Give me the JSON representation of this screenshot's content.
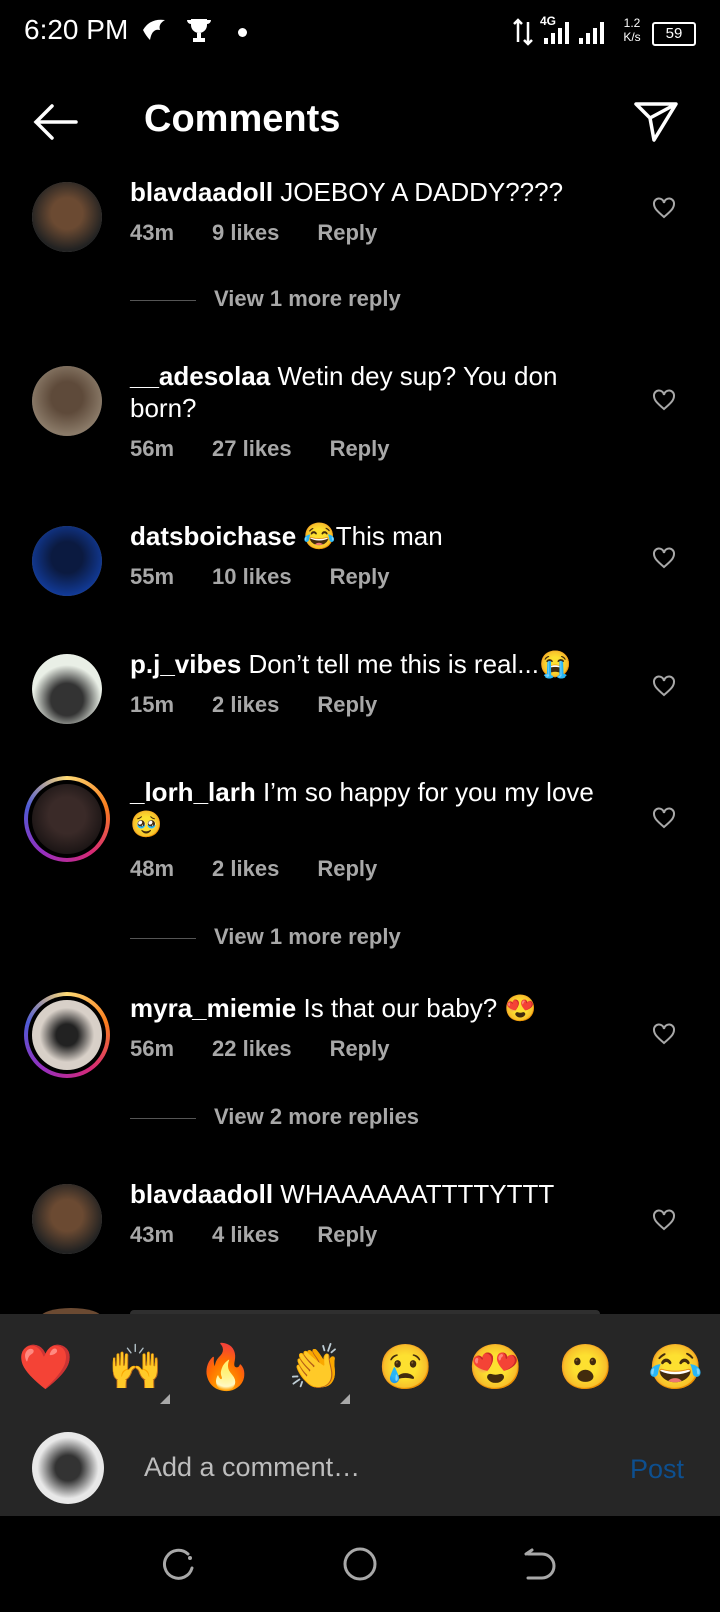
{
  "status_bar": {
    "time": "6:20 PM",
    "network": "4G",
    "speed_value": "1.2",
    "speed_unit": "K/s",
    "battery": "59"
  },
  "header": {
    "title": "Comments"
  },
  "comments": [
    {
      "user": "blavdaadoll",
      "text": "JOEBOY A DADDY????",
      "time": "43m",
      "likes": "9 likes",
      "reply": "Reply",
      "view_more": "View 1 more reply",
      "avatar_color": "#6b4a32"
    },
    {
      "user": "__adesolaa",
      "text": "Wetin dey sup? You don born?",
      "time": "56m",
      "likes": "27 likes",
      "reply": "Reply",
      "avatar_color": "#7a6a58"
    },
    {
      "user": "datsboichase",
      "text": "😂This man",
      "time": "55m",
      "likes": "10 likes",
      "reply": "Reply",
      "avatar_color": "#123c9c"
    },
    {
      "user": "p.j_vibes",
      "text": "Don’t tell me this is real...😭",
      "time": "15m",
      "likes": "2 likes",
      "reply": "Reply",
      "avatar_color": "#e9efe6"
    },
    {
      "user": "_lorh_larh",
      "text": "I’m so happy for you my love 🥹",
      "time": "48m",
      "likes": "2 likes",
      "reply": "Reply",
      "view_more": "View 1 more reply",
      "avatar_color": "#3a2a28"
    },
    {
      "user": "myra_miemie",
      "text": "Is that our baby? 😍",
      "time": "56m",
      "likes": "22 likes",
      "reply": "Reply",
      "view_more": "View 2 more replies",
      "avatar_color": "#d8d0c8"
    },
    {
      "user": "blavdaadoll",
      "text": "WHAAAAAATTTTYTTT",
      "time": "43m",
      "likes": "4 likes",
      "reply": "Reply",
      "avatar_color": "#6b4a32"
    }
  ],
  "emoji_bar": [
    "❤️",
    "🙌",
    "🔥",
    "👏",
    "😢",
    "😍",
    "😮",
    "😂"
  ],
  "composer": {
    "placeholder": "Add a comment…",
    "post_label": "Post"
  },
  "colors": {
    "background": "#000000",
    "secondary_text": "#a8a8a8",
    "panel": "#262626",
    "post_disabled": "#0d4f8f"
  }
}
